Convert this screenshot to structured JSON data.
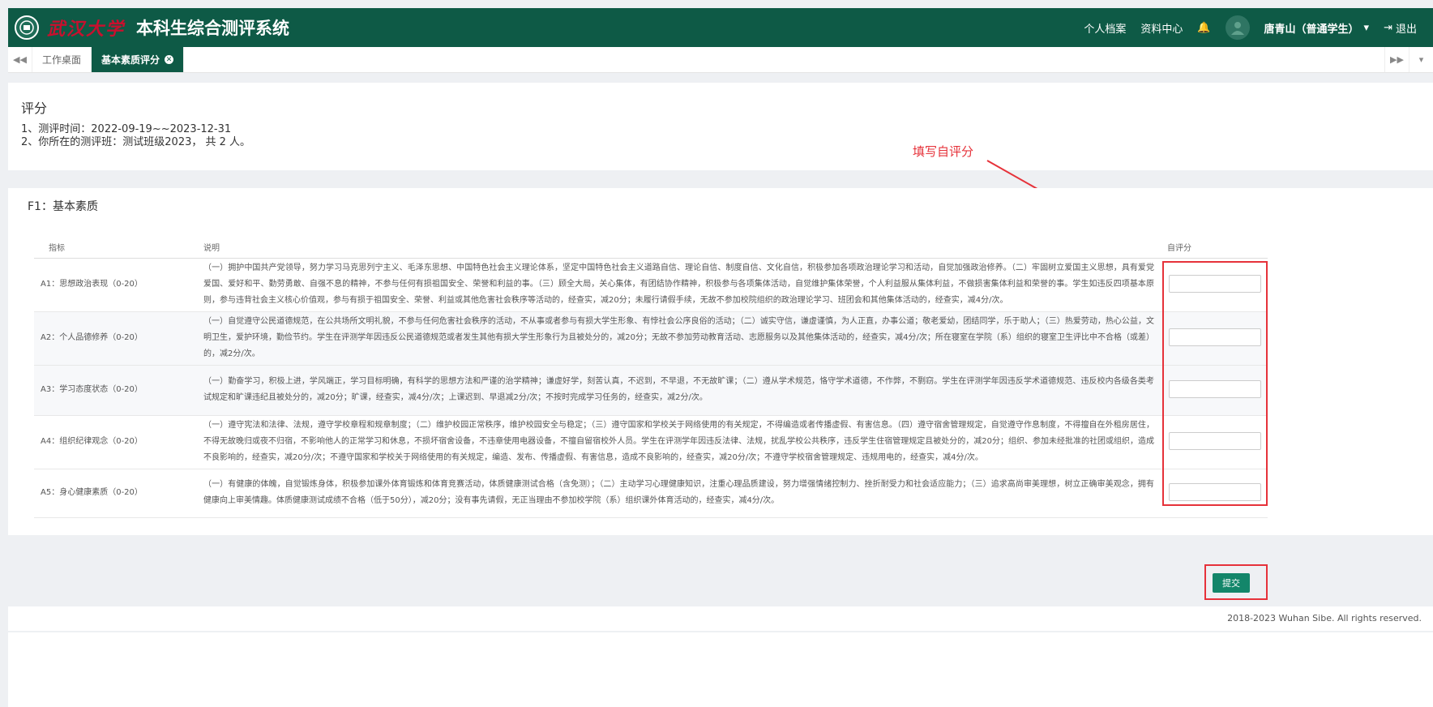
{
  "header": {
    "logo_text": "武汉大学",
    "title": "本科生综合测评系统",
    "nav": [
      "个人档案",
      "资料中心"
    ],
    "user": "唐青山（普通学生）",
    "logout": "退出",
    "icons": [
      "bell-icon",
      "caret-down-icon",
      "logout-icon"
    ]
  },
  "tabs": {
    "items": [
      {
        "label": "工作桌面",
        "active": false
      },
      {
        "label": "基本素质评分",
        "active": true
      }
    ]
  },
  "intro": {
    "title": "评分",
    "line1": "1、测评时间：2022-09-19~~2023-12-31",
    "line2": "2、你所在的测评班：测试班级2023，  共 2  人。"
  },
  "annotation": "填写自评分",
  "section": {
    "title": "F1：基本素质",
    "columns": [
      "指标",
      "说明",
      "自评分"
    ],
    "rows": [
      {
        "indicator": "A1：思想政治表现（0-20）",
        "desc": "（一）拥护中国共产党领导，努力学习马克思列宁主义、毛泽东思想、中国特色社会主义理论体系，坚定中国特色社会主义道路自信、理论自信、制度自信、文化自信，积极参加各项政治理论学习和活动，自觉加强政治修养。（二）牢固树立爱国主义思想，具有爱党爱国、爱好和平、勤劳勇敢、自强不息的精神，不参与任何有损祖国安全、荣誉和利益的事。（三）顾全大局，关心集体，有团结协作精神，积极参与各项集体活动，自觉维护集体荣誉，个人利益服从集体利益，不做损害集体利益和荣誉的事。学生如违反四项基本原则，参与违背社会主义核心价值观，参与有损于祖国安全、荣誉、利益或其他危害社会秩序等活动的，经查实，减20分；未履行请假手续，无故不参加校院组织的政治理论学习、班团会和其他集体活动的，经查实，减4分/次。",
        "score": ""
      },
      {
        "indicator": "A2：个人品德修养（0-20）",
        "desc": "（一）自觉遵守公民道德规范，在公共场所文明礼貌，不参与任何危害社会秩序的活动，不从事或者参与有损大学生形象、有悖社会公序良俗的活动；（二）诚实守信，谦虚谨慎，为人正直，办事公道；敬老爱幼，团结同学，乐于助人；（三）热爱劳动，热心公益，文明卫生，爱护环境，勤俭节约。学生在评测学年因违反公民道德规范或者发生其他有损大学生形象行为且被处分的，减20分；无故不参加劳动教育活动、志愿服务以及其他集体活动的，经查实，减4分/次；所在寝室在学院（系）组织的寝室卫生评比中不合格（或差）的，减2分/次。",
        "score": ""
      },
      {
        "indicator": "A3：学习态度状态（0-20）",
        "desc": "（一）勤奋学习，积极上进，学风端正，学习目标明确，有科学的思想方法和严谨的治学精神；谦虚好学，刻苦认真，不迟到，不早退，不无故旷课；（二）遵从学术规范，恪守学术道德，不作弊，不剽窃。学生在评测学年因违反学术道德规范、违反校内各级各类考试规定和旷课违纪且被处分的，减20分；旷课，经查实，减4分/次；上课迟到、早退减2分/次；不按时完成学习任务的，经查实，减2分/次。",
        "score": ""
      },
      {
        "indicator": "A4：组织纪律观念（0-20）",
        "desc": "（一）遵守宪法和法律、法规，遵守学校章程和规章制度；（二）维护校园正常秩序，维护校园安全与稳定；（三）遵守国家和学校关于网络使用的有关规定，不得编造或者传播虚假、有害信息。（四）遵守宿舍管理规定，自觉遵守作息制度，不得擅自在外租房居住，不得无故晚归或夜不归宿，不影响他人的正常学习和休息，不损坏宿舍设备，不违章使用电器设备，不擅自留宿校外人员。学生在评测学年因违反法律、法规，扰乱学校公共秩序，违反学生住宿管理规定且被处分的，减20分；组织、参加未经批准的社团或组织，造成不良影响的，经查实，减20分/次；不遵守国家和学校关于网络使用的有关规定，编造、发布、传播虚假、有害信息，造成不良影响的，经查实，减20分/次；不遵守学校宿舍管理规定、违规用电的，经查实，减4分/次。",
        "score": ""
      },
      {
        "indicator": "A5：身心健康素质（0-20）",
        "desc": "（一）有健康的体魄，自觉锻炼身体，积极参加课外体育锻炼和体育竞赛活动，体质健康测试合格（含免测）；（二）主动学习心理健康知识，注重心理品质建设，努力增强情绪控制力、挫折耐受力和社会适应能力；（三）追求高尚审美理想，树立正确审美观念，拥有健康向上审美情趣。体质健康测试成绩不合格（低于50分），减20分；没有事先请假，无正当理由不参加校学院（系）组织课外体育活动的，经查实，减4分/次。",
        "score": ""
      }
    ]
  },
  "submit_label": "提交",
  "footer": "2018-2023 Wuhan Sibe. All rights reserved.",
  "colors": {
    "primary": "#0e5a46",
    "button": "#13866a",
    "annotation": "#e6323a"
  }
}
